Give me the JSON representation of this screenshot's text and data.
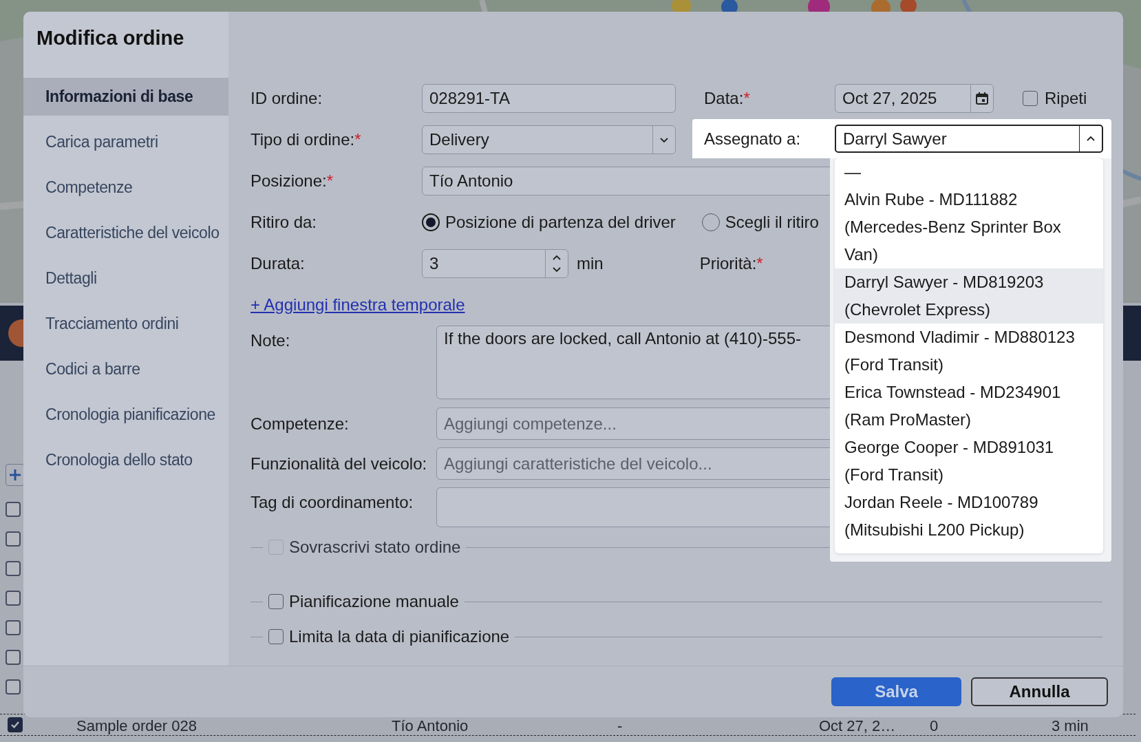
{
  "background": {
    "rows": [
      {
        "checked": false,
        "cells": []
      },
      {
        "checked": false,
        "cells": []
      },
      {
        "checked": false,
        "cells": []
      },
      {
        "checked": false,
        "cells": []
      },
      {
        "checked": false,
        "cells": []
      },
      {
        "checked": false,
        "cells": []
      },
      {
        "checked": false,
        "cells": []
      },
      {
        "checked": true,
        "cells": [
          "Sample order 028",
          "Tío Antonio",
          "-",
          "Oct 27, 2…",
          "0",
          "3 min"
        ]
      }
    ]
  },
  "dialog": {
    "title": "Modifica ordine"
  },
  "sidebar": {
    "items": [
      {
        "label": "Informazioni di base",
        "selected": true
      },
      {
        "label": "Carica parametri",
        "selected": false
      },
      {
        "label": "Competenze",
        "selected": false
      },
      {
        "label": "Caratteristiche del veicolo",
        "selected": false
      },
      {
        "label": "Dettagli",
        "selected": false
      },
      {
        "label": "Tracciamento ordini",
        "selected": false
      },
      {
        "label": "Codici a barre",
        "selected": false
      },
      {
        "label": "Cronologia pianificazione",
        "selected": false
      },
      {
        "label": "Cronologia dello stato",
        "selected": false
      }
    ]
  },
  "form": {
    "order_id": {
      "label": "ID ordine:",
      "value": "028291-TA"
    },
    "date": {
      "label": "Data:",
      "asterisk": "*",
      "value": "Oct 27, 2025"
    },
    "repeat": {
      "label": "Ripeti",
      "checked": false
    },
    "order_type": {
      "label": "Tipo di ordine:",
      "asterisk": "*",
      "value": "Delivery"
    },
    "assigned_to": {
      "label": "Assegnato a:",
      "value": "Darryl Sawyer",
      "expanded": true,
      "options": [
        {
          "label": "—",
          "selected": false
        },
        {
          "label": "Alvin Rube - MD111882 (Mercedes-Benz Sprinter Box Van)",
          "selected": false
        },
        {
          "label": "Darryl Sawyer - MD819203 (Chevrolet Express)",
          "selected": true
        },
        {
          "label": "Desmond Vladimir - MD880123 (Ford Transit)",
          "selected": false
        },
        {
          "label": "Erica Townstead - MD234901 (Ram ProMaster)",
          "selected": false
        },
        {
          "label": "George Cooper - MD891031 (Ford Transit)",
          "selected": false
        },
        {
          "label": "Jordan Reele - MD100789 (Mitsubishi L200 Pickup)",
          "selected": false
        }
      ]
    },
    "position": {
      "label": "Posizione:",
      "asterisk": "*",
      "value": "Tío Antonio"
    },
    "pickup": {
      "label": "Ritiro da:",
      "options": [
        {
          "label": "Posizione di partenza del driver",
          "selected": true
        },
        {
          "label": "Scegli il ritiro",
          "selected": false
        }
      ]
    },
    "duration": {
      "label": "Durata:",
      "value": "3",
      "unit": "min"
    },
    "priority": {
      "label": "Priorità:",
      "asterisk": "*"
    },
    "add_time_window": {
      "label": "+ Aggiungi finestra temporale"
    },
    "notes": {
      "label": "Note:",
      "value": "If the doors are locked, call Antonio at (410)-555-"
    },
    "skills": {
      "label": "Competenze:",
      "placeholder": "Aggiungi competenze..."
    },
    "vehicle_features": {
      "label": "Funzionalità del veicolo:",
      "placeholder": "Aggiungi caratteristiche del veicolo..."
    },
    "coordination_tags": {
      "label": "Tag di coordinamento:"
    },
    "sections": [
      {
        "label": "Sovrascrivi stato ordine",
        "checked": false,
        "disabled": true
      },
      {
        "label": "Pianificazione manuale",
        "checked": false,
        "disabled": false
      },
      {
        "label": "Limita la data di pianificazione",
        "checked": false,
        "disabled": false
      }
    ]
  },
  "buttons": [
    {
      "label": "Salva",
      "kind": "primary"
    },
    {
      "label": "Annulla",
      "kind": "secondary"
    }
  ]
}
